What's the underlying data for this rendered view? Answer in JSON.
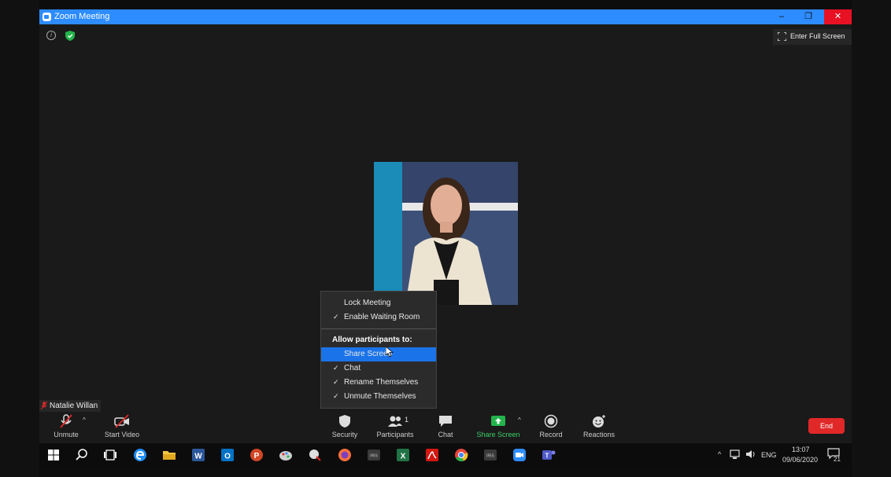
{
  "window": {
    "title": "Zoom Meeting",
    "controls": {
      "minimize": "–",
      "maximize": "❐",
      "close": "✕"
    }
  },
  "header": {
    "fullscreen_label": "Enter Full Screen"
  },
  "participant": {
    "name": "Natalie Willan"
  },
  "security_menu": {
    "items": [
      {
        "label": "Lock Meeting",
        "checked": false
      },
      {
        "label": "Enable Waiting Room",
        "checked": true
      }
    ],
    "section_heading": "Allow participants to:",
    "permissions": [
      {
        "label": "Share Screen",
        "checked": false,
        "highlighted": true
      },
      {
        "label": "Chat",
        "checked": true
      },
      {
        "label": "Rename Themselves",
        "checked": true
      },
      {
        "label": "Unmute Themselves",
        "checked": true
      }
    ],
    "check_glyph": "✓"
  },
  "toolbar": {
    "unmute": "Unmute",
    "start_video": "Start Video",
    "security": "Security",
    "participants": "Participants",
    "participants_count": "1",
    "chat": "Chat",
    "share_screen": "Share Screen",
    "record": "Record",
    "reactions": "Reactions",
    "end": "End",
    "caret": "^"
  },
  "taskbar": {
    "icons": [
      "windows-start-icon",
      "search-icon",
      "task-view-icon",
      "edge-icon",
      "file-explorer-icon",
      "word-icon",
      "outlook-icon",
      "powerpoint-icon",
      "paint-icon",
      "app-icon",
      "firefox-icon",
      "iris-icon",
      "excel-icon",
      "acrobat-icon",
      "chrome-icon",
      "iris-d-icon",
      "zoom-icon",
      "teams-icon"
    ],
    "language": "ENG",
    "time": "13:07",
    "date": "09/06/2020",
    "notifications": "21"
  },
  "colors": {
    "zoom_blue": "#2d8cff",
    "end_red": "#e02828",
    "share_green": "#24b34b",
    "highlight": "#1a73e8"
  }
}
